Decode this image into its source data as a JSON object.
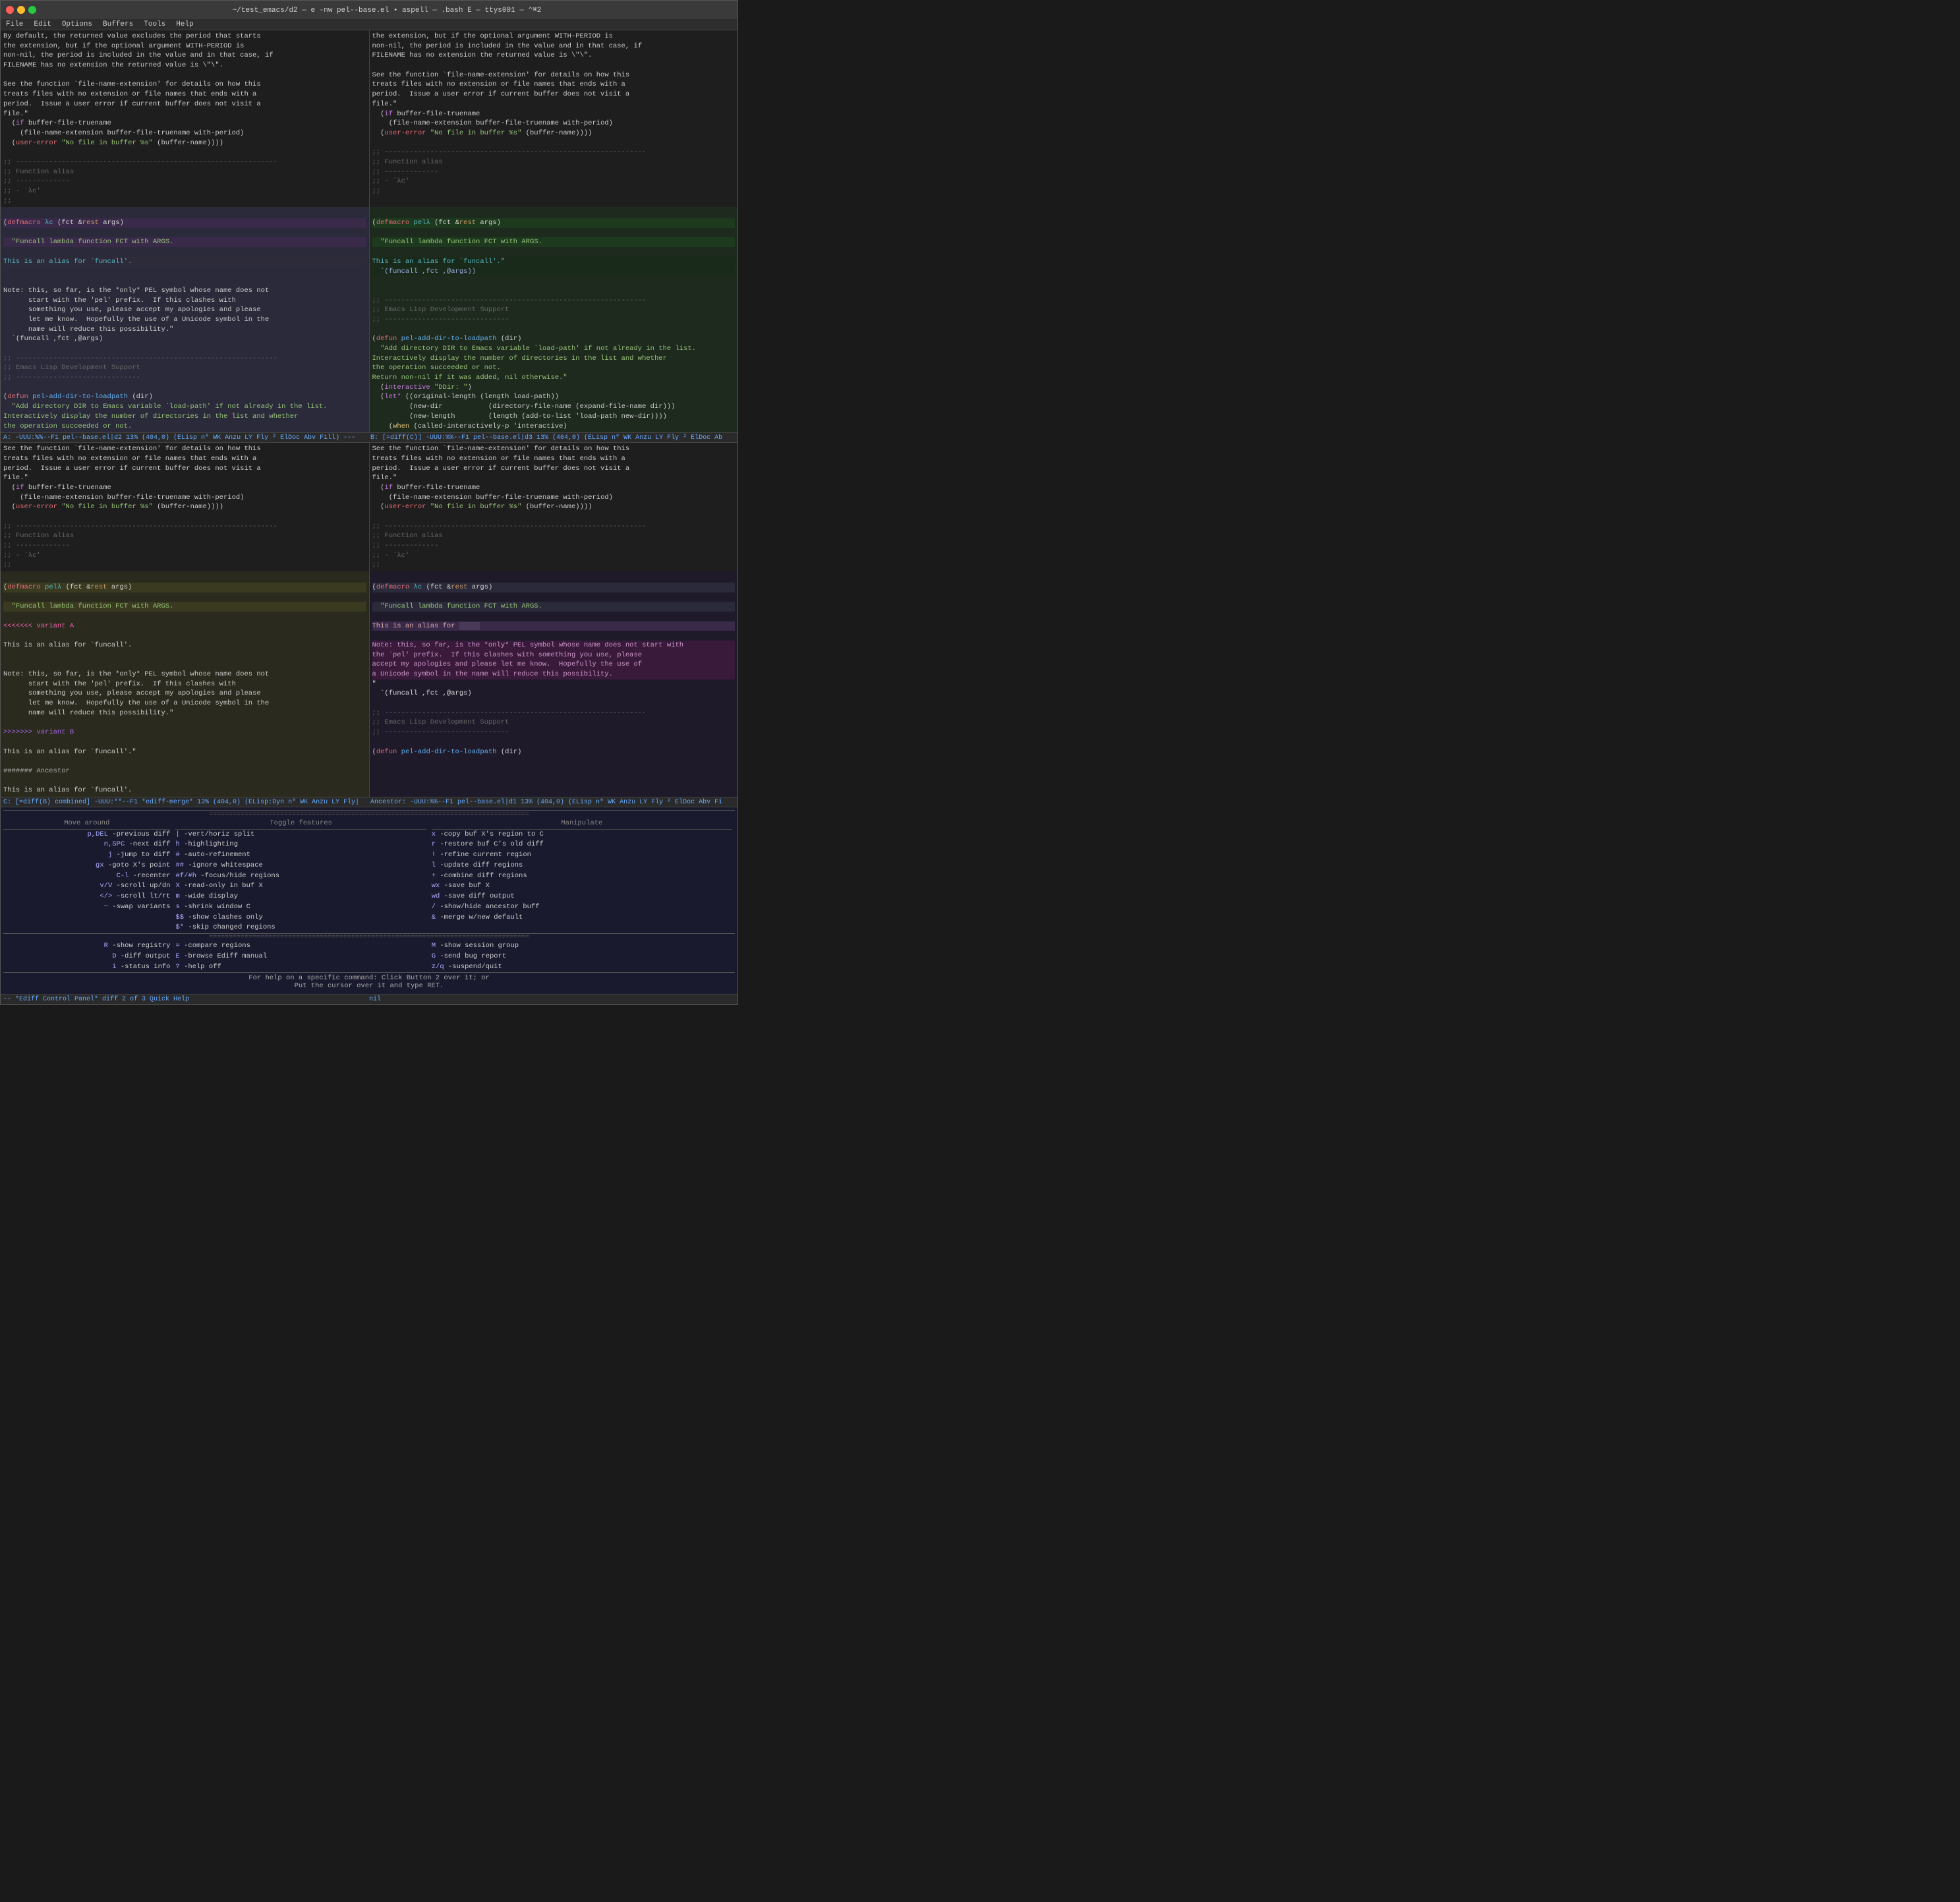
{
  "window": {
    "title": "~/test_emacs/d2 — e -nw pel--base.el • aspell — .bash E — ttys001 — ⌃⌘2",
    "traffic": [
      "red",
      "yellow",
      "green"
    ]
  },
  "menu": {
    "items": [
      "File",
      "Edit",
      "Options",
      "Buffers",
      "Tools",
      "Help"
    ]
  },
  "title_bar": "~/test_emacs/d2 — e -nw pel--base.el • aspell — .bash E — ttys001 — ⌃⌘2",
  "status_a": "A: -UUU:%%--F1  pel--base.el|d2   13% (404,0)    (ELisp n⁰ WK Anzu LY Fly ² ElDoc Abv Fill) ---",
  "status_b": "B: [=diff(C)] -UUU:%%--F1  pel--base.el|d3   13% (404,0)    (ELisp n⁰ WK Anzu LY Fly ² ElDoc Ab",
  "status_c": "C: [=diff(B) combined] -UUU:**--F1  *ediff-merge*   13% (404,0)    (ELisp:Dyn n⁰ WK Anzu LY Fly|",
  "status_ancestor": "Ancestor: -UUU:%%--F1  pel--base.el|d1   13% (404,0)    (ELisp n⁰ WK Anzu LY Fly ² ElDoc Abv Fi",
  "bottom_status": "-- *Ediff Control Panel*  diff 2 of 3    Quick Help",
  "bottom_right_status": "nil",
  "footer_line1": "For help on a specific command:  Click Button 2 over it; or",
  "footer_line2": "                                 Put the cursor over it and type RET.",
  "ediff": {
    "section1_header": "Move around",
    "section2_header": "Toggle features",
    "section3_header": "Manipulate",
    "col1": [
      "p,DEL -previous diff",
      "n,SPC -next diff",
      "j -jump to diff",
      "gx -goto X's point",
      "C-l -recenter",
      "v/V -scroll up/dn",
      "</> -scroll lt/rt",
      "~ -swap variants"
    ],
    "col2": [
      "|-vert/horiz split",
      "h -highlighting",
      "# -auto-refinement",
      "## -ignore whitespace",
      "#f/#h -focus/hide regions",
      "X -read-only in buf X",
      "m -wide display",
      "s -shrink window C",
      "$$ -show clashes only",
      "$* -skip changed regions"
    ],
    "col3": [
      "x -copy buf X's region to C",
      "r -restore buf C's old diff",
      "! -refine current region",
      "l -update diff regions",
      "+ -combine diff regions",
      "wx -save buf X",
      "wd -save diff output",
      "/ -show/hide ancestor buff",
      "& -merge w/new default"
    ],
    "col4_header": "",
    "col4": [
      "R -show registry",
      "D -diff output",
      "i -status info"
    ],
    "col5": [
      "= -compare regions",
      "E -browse Ediff manual",
      "? -help off"
    ],
    "col6": [
      "M  -show session group",
      "G  -send bug report",
      "z/q -suspend/quit"
    ]
  }
}
